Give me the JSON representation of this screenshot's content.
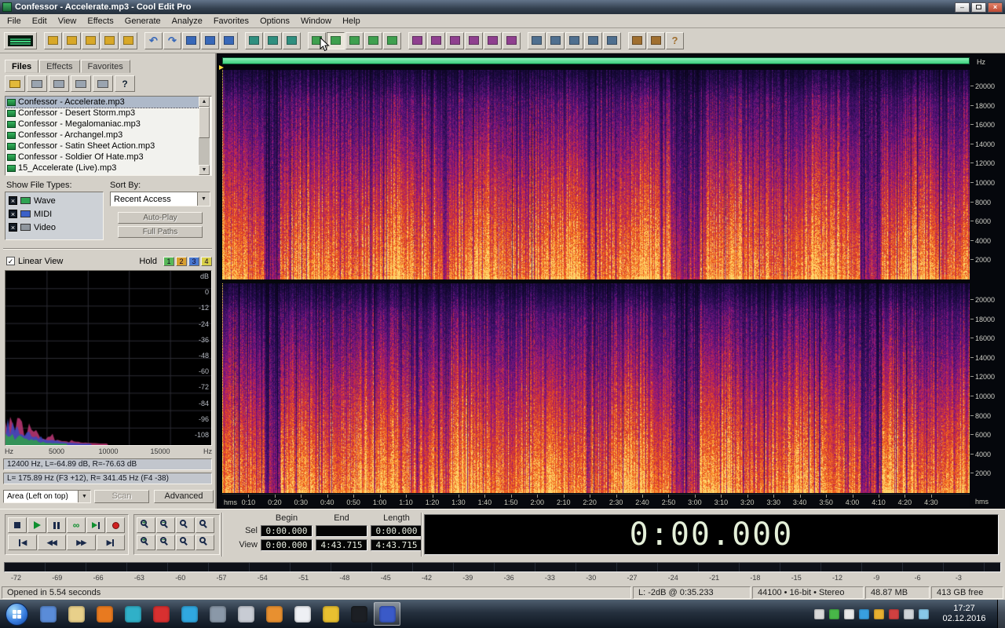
{
  "window": {
    "title": "Confessor - Accelerate.mp3 - Cool Edit Pro",
    "controls": [
      "minimize",
      "maximize",
      "close"
    ]
  },
  "menu": {
    "items": [
      "File",
      "Edit",
      "View",
      "Effects",
      "Generate",
      "Analyze",
      "Favorites",
      "Options",
      "Window",
      "Help"
    ]
  },
  "toolbar": {
    "groups": [
      {
        "buttons": [
          {
            "name": "edit-multitrack-toggle",
            "wide": true
          }
        ]
      },
      {
        "buttons": [
          {
            "name": "new-file"
          },
          {
            "name": "open-file"
          },
          {
            "name": "save-file"
          },
          {
            "name": "save-as"
          },
          {
            "name": "close-file"
          }
        ]
      },
      {
        "buttons": [
          {
            "name": "undo"
          },
          {
            "name": "redo"
          },
          {
            "name": "cut"
          },
          {
            "name": "copy"
          },
          {
            "name": "paste"
          }
        ]
      },
      {
        "buttons": [
          {
            "name": "mix-paste"
          },
          {
            "name": "crop"
          },
          {
            "name": "delete-selection"
          }
        ]
      },
      {
        "buttons": [
          {
            "name": "waveform-view"
          },
          {
            "name": "spectral-view",
            "active": true
          },
          {
            "name": "frequency-analysis"
          },
          {
            "name": "phase-analysis"
          },
          {
            "name": "statistics"
          }
        ]
      },
      {
        "buttons": [
          {
            "name": "amplify"
          },
          {
            "name": "normalize"
          },
          {
            "name": "envelope"
          },
          {
            "name": "compressor"
          },
          {
            "name": "reverb"
          },
          {
            "name": "delay"
          }
        ]
      },
      {
        "buttons": [
          {
            "name": "noise-reduction"
          },
          {
            "name": "fft-filter"
          },
          {
            "name": "batch-script"
          },
          {
            "name": "cue-list"
          },
          {
            "name": "play-list"
          }
        ]
      },
      {
        "buttons": [
          {
            "name": "options"
          },
          {
            "name": "keyboard-shortcuts"
          },
          {
            "name": "help"
          }
        ]
      }
    ]
  },
  "organizer": {
    "tabs": [
      {
        "label": "Files",
        "active": true
      },
      {
        "label": "Effects"
      },
      {
        "label": "Favorites"
      }
    ],
    "toolbar": [
      "open-file",
      "close-file",
      "file-info",
      "refresh-list",
      "list-options",
      "help"
    ],
    "files": [
      {
        "name": "Confessor - Accelerate.mp3",
        "selected": true
      },
      {
        "name": "Confessor - Desert Storm.mp3"
      },
      {
        "name": "Confessor - Megalomaniac.mp3"
      },
      {
        "name": "Confessor - Archangel.mp3"
      },
      {
        "name": "Confessor - Satin Sheet Action.mp3"
      },
      {
        "name": "Confessor - Soldier Of Hate.mp3"
      },
      {
        "name": "15_Accelerate (Live).mp3"
      }
    ],
    "show_file_types_label": "Show File Types:",
    "sort_by_label": "Sort By:",
    "file_types": [
      {
        "label": "Wave",
        "checked": true
      },
      {
        "label": "MIDI",
        "checked": true
      },
      {
        "label": "Video",
        "checked": true
      }
    ],
    "sort_value": "Recent Access",
    "auto_play_label": "Auto-Play",
    "full_paths_label": "Full Paths"
  },
  "analysis": {
    "linear_view_label": "Linear View",
    "linear_view_checked": true,
    "hold_label": "Hold",
    "hold_buttons": [
      {
        "label": "1",
        "color": "#58b858"
      },
      {
        "label": "2",
        "color": "#d8a030"
      },
      {
        "label": "3",
        "color": "#4878d0"
      },
      {
        "label": "4",
        "color": "#d8d048"
      }
    ],
    "db_labels": [
      "dB",
      "0",
      "-12",
      "-24",
      "-36",
      "-48",
      "-60",
      "-72",
      "-84",
      "-96",
      "-108"
    ],
    "hz_labels": [
      "Hz",
      "5000",
      "10000",
      "15000",
      "Hz"
    ],
    "status_line1": "12400 Hz, L=-64.89 dB, R=-76.63 dB",
    "status_line2": "L= 175.89 Hz (F3 +12), R= 341.45 Hz (F4 -38)",
    "area_select_value": "Area (Left on top)",
    "scan_label": "Scan",
    "advanced_label": "Advanced"
  },
  "spectral": {
    "freq_unit": "Hz",
    "freq_ticks": [
      "20000",
      "18000",
      "16000",
      "14000",
      "12000",
      "10000",
      "8000",
      "6000",
      "4000",
      "2000"
    ],
    "timeline_unit": "hms",
    "timeline_ticks": [
      "0:10",
      "0:20",
      "0:30",
      "0:40",
      "0:50",
      "1:00",
      "1:10",
      "1:20",
      "1:30",
      "1:40",
      "1:50",
      "2:00",
      "2:10",
      "2:20",
      "2:30",
      "2:40",
      "2:50",
      "3:00",
      "3:10",
      "3:20",
      "3:30",
      "3:40",
      "3:50",
      "4:00",
      "4:10",
      "4:20",
      "4:30"
    ],
    "total_seconds": 284.7
  },
  "transport": {
    "row1": [
      "stop",
      "play",
      "pause",
      "play-looped",
      "play-to-end",
      "record"
    ],
    "row2": [
      "go-to-beginning",
      "rewind",
      "fast-forward",
      "go-to-end"
    ]
  },
  "zoom": {
    "row1": [
      "zoom-in-horizontal",
      "zoom-out-horizontal",
      "zoom-full",
      "zoom-to-selection"
    ],
    "row2": [
      "zoom-in-vertical",
      "zoom-out-vertical",
      "zoom-left-edge",
      "zoom-right-edge"
    ]
  },
  "time": {
    "headers": [
      "Begin",
      "End",
      "Length"
    ],
    "rows": [
      {
        "label": "Sel",
        "values": [
          "0:00.000",
          "",
          "0:00.000"
        ]
      },
      {
        "label": "View",
        "values": [
          "0:00.000",
          "4:43.715",
          "4:43.715"
        ]
      }
    ],
    "main_display": "0:00.000"
  },
  "meter": {
    "labels": [
      "-72",
      "-69",
      "-66",
      "-63",
      "-60",
      "-57",
      "-54",
      "-51",
      "-48",
      "-45",
      "-42",
      "-39",
      "-36",
      "-33",
      "-30",
      "-27",
      "-24",
      "-21",
      "-18",
      "-15",
      "-12",
      "-9",
      "-6",
      "-3"
    ]
  },
  "statusbar": {
    "message": "Opened in 5.54 seconds",
    "cells": [
      "L: -2dB @  0:35.233",
      "44100 • 16-bit • Stereo",
      "48.87 MB",
      "413 GB free"
    ]
  },
  "taskbar": {
    "apps": [
      {
        "name": "calculator",
        "color": "#5a8cd8"
      },
      {
        "name": "file-explorer",
        "color": "#e8d08a"
      },
      {
        "name": "firefox",
        "color": "#e87a20"
      },
      {
        "name": "media-player",
        "color": "#30b0c8"
      },
      {
        "name": "opera",
        "color": "#d83030"
      },
      {
        "name": "skype",
        "color": "#30a8e0"
      },
      {
        "name": "phone-suite",
        "color": "#8a98a8"
      },
      {
        "name": "search-tool",
        "color": "#c8ccd4"
      },
      {
        "name": "disc-burner",
        "color": "#e89030"
      },
      {
        "name": "ghost-browser",
        "color": "#eef0f4"
      },
      {
        "name": "chrome",
        "color": "#e8c030"
      },
      {
        "name": "command-prompt",
        "color": "#1c1f24"
      },
      {
        "name": "cool-edit-pro",
        "color": "#3a5ac8",
        "active": true
      }
    ],
    "tray": [
      {
        "name": "show-hidden-icons",
        "color": "#d8d8d8"
      },
      {
        "name": "tray-antivirus",
        "color": "#48b848"
      },
      {
        "name": "tray-graphics",
        "color": "#e8e8e8"
      },
      {
        "name": "tray-cloud",
        "color": "#38a0e0"
      },
      {
        "name": "tray-update",
        "color": "#e8b030"
      },
      {
        "name": "tray-security",
        "color": "#d04040"
      },
      {
        "name": "tray-volume",
        "color": "#d0d4d8"
      },
      {
        "name": "tray-network",
        "color": "#88c8e8"
      }
    ],
    "clock_time": "17:27",
    "clock_date": "02.12.2016"
  },
  "colors": {
    "range_bar_green": "#3ed47e",
    "range_bar_green_light": "#8af0b8",
    "big_time_text": "#e4efd8",
    "play_green": "#0f8f2f",
    "record_red": "#d02020"
  }
}
